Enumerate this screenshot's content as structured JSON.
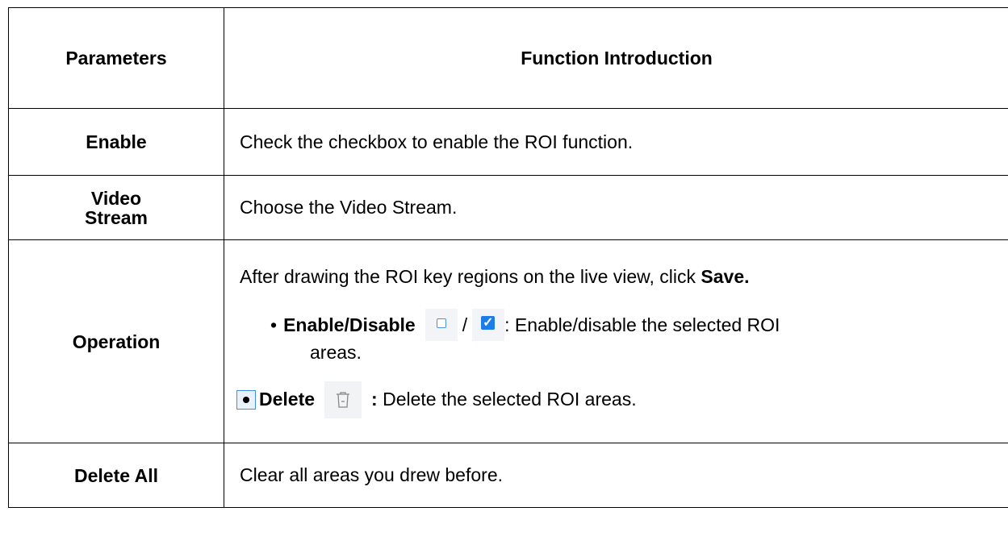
{
  "header": {
    "col1": "Parameters",
    "col2": "Function Introduction"
  },
  "rows": {
    "enable": {
      "name": "Enable",
      "description": "Check the checkbox to enable the ROI function."
    },
    "video_stream": {
      "name_line1": "Video",
      "name_line2": "Stream",
      "description": "Choose the Video Stream."
    },
    "operation": {
      "name": "Operation",
      "intro": "After drawing the ROI key regions on the live view, click ",
      "intro_bold": "Save.",
      "enable_disable_label": "Enable/Disable",
      "slash": "/",
      "enable_disable_text": ": Enable/disable the selected ROI",
      "enable_disable_wrap": "areas.",
      "delete_label": "Delete",
      "delete_colon": ":",
      "delete_text": " Delete the selected ROI areas."
    },
    "delete_all": {
      "name": "Delete All",
      "description": "Clear all areas you drew before."
    }
  },
  "icons": {
    "unchecked": "checkbox-unchecked-icon",
    "checked": "checkbox-checked-icon",
    "trash": "trash-icon",
    "radio": "radio-selected-icon",
    "accent": "#1e7ce8"
  }
}
